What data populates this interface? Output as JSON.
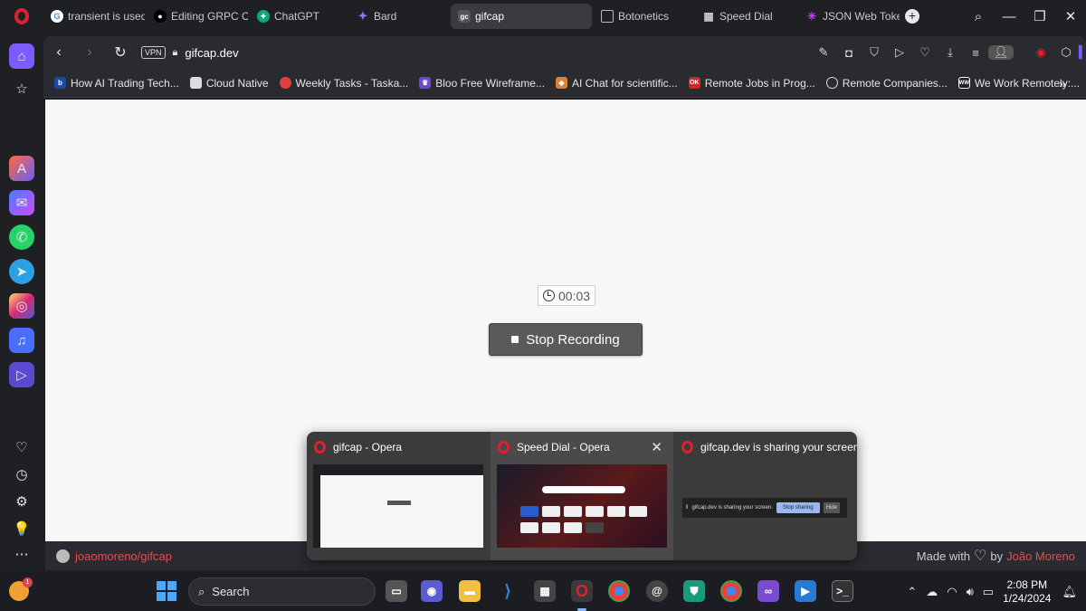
{
  "tabs": [
    {
      "label": "transient is used",
      "icon": "google-icon",
      "color": "#4285f4"
    },
    {
      "label": "Editing GRPC Cra",
      "icon": "medium-icon",
      "color": "#000000"
    },
    {
      "label": "ChatGPT",
      "icon": "chatgpt-icon",
      "color": "#10a37f"
    },
    {
      "label": "Bard",
      "icon": "bard-icon",
      "color": "#8e75ff"
    },
    {
      "label": "gifcap",
      "icon": "gifcap-icon",
      "color": "#555555",
      "active": true
    },
    {
      "label": "Botonetics",
      "icon": "film-icon",
      "color": "#888888"
    },
    {
      "label": "Speed Dial",
      "icon": "grid-icon",
      "color": "#888888"
    },
    {
      "label": "JSON Web Token",
      "icon": "jwt-icon",
      "color": "#d63aff"
    }
  ],
  "address": {
    "vpn_label": "VPN",
    "url": "gifcap.dev"
  },
  "bookmarks": [
    {
      "label": "How AI Trading Tech...",
      "color": "#1a4aa0",
      "glyph": "b"
    },
    {
      "label": "Cloud Native",
      "color": "#dddddd",
      "glyph": ""
    },
    {
      "label": "Weekly Tasks - Taska...",
      "color": "#e04040",
      "glyph": ""
    },
    {
      "label": "Bloo Free Wireframe...",
      "color": "#6a4ad0",
      "glyph": ""
    },
    {
      "label": "AI Chat for scientific...",
      "color": "#e08030",
      "glyph": ""
    },
    {
      "label": "Remote Jobs in Prog...",
      "color": "#e02020",
      "glyph": "OK"
    },
    {
      "label": "Remote Companies...",
      "color": "#555555",
      "glyph": ""
    },
    {
      "label": "We Work Remotely:...",
      "color": "#222222",
      "glyph": "WW"
    }
  ],
  "recorder": {
    "elapsed": "00:03",
    "stop_label": "Stop Recording"
  },
  "footer": {
    "repo": "joaomoreno/gifcap",
    "made_with": "Made with",
    "by": "by",
    "author": "João Moreno"
  },
  "preview": {
    "cards": [
      {
        "title": "gifcap - Opera"
      },
      {
        "title": "Speed Dial - Opera"
      },
      {
        "title": "gifcap.dev is sharing your screen."
      }
    ],
    "share_text": "gifcap.dev is sharing your screen.",
    "stop_sharing": "Stop sharing",
    "hide": "Hide",
    "mini_recording": "Stop Recording",
    "speed_dial_tiles": [
      "facebook",
      "yahoo!",
      "YouTube",
      "amazon",
      "ebay"
    ]
  },
  "taskbar": {
    "search_placeholder": "Search",
    "weather_badge": "1",
    "time": "2:08 PM",
    "date": "1/24/2024"
  }
}
